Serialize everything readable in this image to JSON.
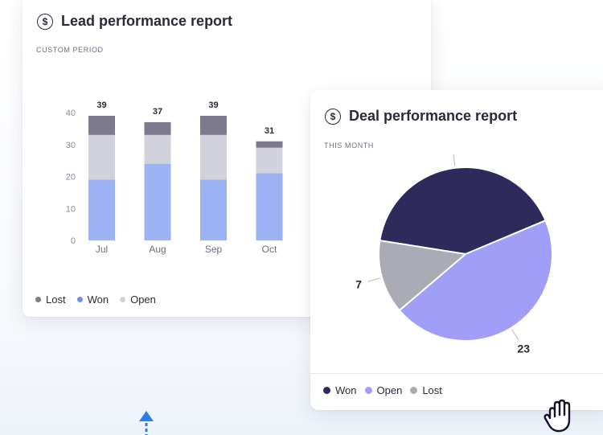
{
  "lead": {
    "title": "Lead performance report",
    "subtitle": "CUSTOM PERIOD",
    "legend": [
      "Lost",
      "Won",
      "Open"
    ]
  },
  "deal": {
    "title": "Deal performance report",
    "subtitle": "THIS MONTH",
    "legend": [
      "Won",
      "Open",
      "Lost"
    ]
  },
  "colors": {
    "won_bar": "#9db2f3",
    "open_bar": "#d1d2db",
    "lost_bar": "#7d7a8e",
    "pie_won": "#2e2a5c",
    "pie_open": "#a09ef6",
    "pie_lost": "#ababb6",
    "accent_arrow": "#2f7bea"
  },
  "chart_data": [
    {
      "type": "bar",
      "stacked": true,
      "title": "Lead performance report",
      "categories": [
        "Jul",
        "Aug",
        "Sep",
        "Oct"
      ],
      "series": [
        {
          "name": "Won",
          "values": [
            19,
            24,
            19,
            21
          ]
        },
        {
          "name": "Open",
          "values": [
            14,
            9,
            14,
            8
          ]
        },
        {
          "name": "Lost",
          "values": [
            6,
            4,
            6,
            2
          ]
        }
      ],
      "totals": [
        39,
        37,
        39,
        31
      ],
      "ylim": [
        0,
        40
      ],
      "yticks": [
        0,
        10,
        20,
        30,
        40
      ],
      "legend_position": "bottom-left"
    },
    {
      "type": "pie",
      "title": "Deal performance report",
      "labels": [
        "Won",
        "Open",
        "Lost"
      ],
      "values": [
        21,
        23,
        7
      ],
      "legend_position": "bottom-left"
    }
  ]
}
